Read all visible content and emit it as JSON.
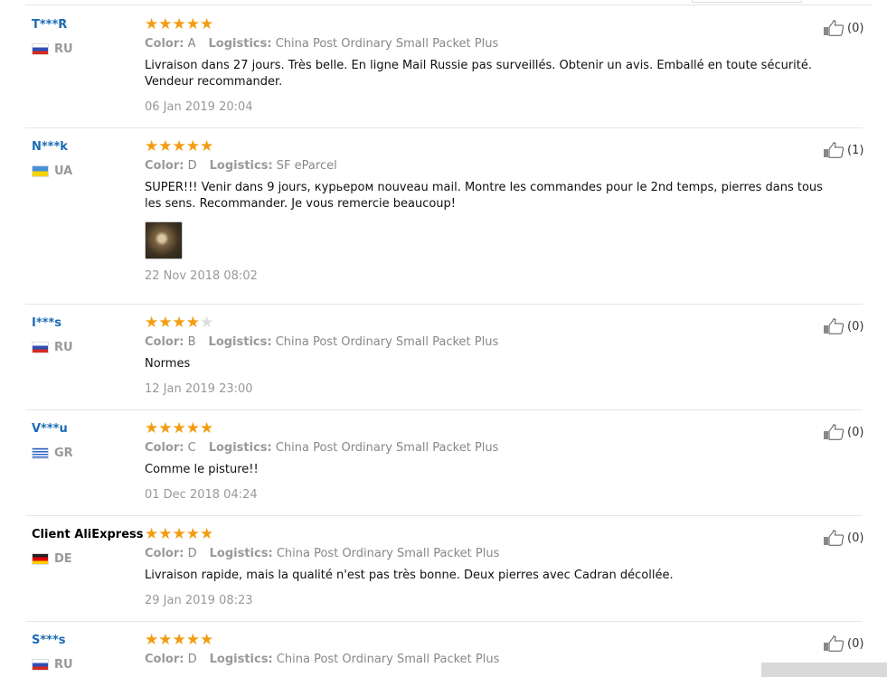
{
  "reviews": [
    {
      "user": "T***R",
      "country": "RU",
      "flag": "ru",
      "rating": 5,
      "color_label": "Color:",
      "color": "A",
      "logistics_label": "Logistics:",
      "logistics": "China Post Ordinary Small Packet Plus",
      "text": "Livraison dans 27 jours. Très belle. En ligne Mail Russie pas surveillés. Obtenir un avis. Emballé en toute sécurité. Vendeur recommander.",
      "date": "06 Jan 2019 20:04",
      "likes": "(0)",
      "has_image": false
    },
    {
      "user": "N***k",
      "country": "UA",
      "flag": "ua",
      "rating": 5,
      "color_label": "Color:",
      "color": "D",
      "logistics_label": "Logistics:",
      "logistics": "SF eParcel",
      "text": "SUPER!!! Venir dans 9 jours, курьером nouveau mail. Montre les commandes pour le 2nd temps, pierres dans tous les sens. Recommander. Je vous remercie beaucoup!",
      "date": "22 Nov 2018 08:02",
      "likes": "(1)",
      "has_image": true
    },
    {
      "user": "I***s",
      "country": "RU",
      "flag": "ru",
      "rating": 4,
      "color_label": "Color:",
      "color": "B",
      "logistics_label": "Logistics:",
      "logistics": "China Post Ordinary Small Packet Plus",
      "text": "Normes",
      "date": "12 Jan 2019 23:00",
      "likes": "(0)",
      "has_image": false
    },
    {
      "user": "V***u",
      "country": "GR",
      "flag": "gr",
      "rating": 5,
      "color_label": "Color:",
      "color": "C",
      "logistics_label": "Logistics:",
      "logistics": "China Post Ordinary Small Packet Plus",
      "text": "Comme le pisture!!",
      "date": "01 Dec 2018 04:24",
      "likes": "(0)",
      "has_image": false
    },
    {
      "user": "Client AliExpress",
      "country": "DE",
      "flag": "de",
      "rating": 5,
      "color_label": "Color:",
      "color": "D",
      "logistics_label": "Logistics:",
      "logistics": "China Post Ordinary Small Packet Plus",
      "text": "Livraison rapide, mais la qualité n'est pas très bonne. Deux pierres avec Cadran décollée.",
      "date": "29 Jan 2019 08:23",
      "likes": "(0)",
      "has_image": false,
      "plain_user": true
    },
    {
      "user": "S***s",
      "country": "RU",
      "flag": "ru",
      "rating": 5,
      "color_label": "Color:",
      "color": "D",
      "logistics_label": "Logistics:",
      "logistics": "China Post Ordinary Small Packet Plus",
      "text": "",
      "date": "",
      "likes": "(0)",
      "has_image": false
    }
  ],
  "colors": {
    "star": "#f39c12",
    "link": "#1a6bb5",
    "meta": "#999999"
  },
  "icons": {
    "like": "thumbs-up-icon",
    "star": "star-icon"
  }
}
